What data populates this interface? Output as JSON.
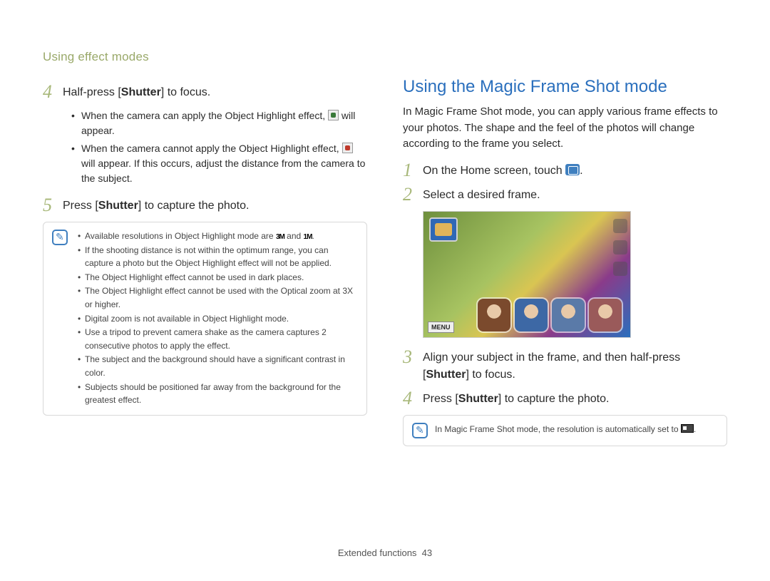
{
  "breadcrumb": "Using effect modes",
  "left": {
    "step4": {
      "num": "4",
      "pre": "Half-press [",
      "bold": "Shutter",
      "post": "] to focus."
    },
    "sub4": {
      "a_pre": "When the camera can apply the Object Highlight effect, ",
      "a_post": " will appear.",
      "b_pre": "When the camera cannot apply the Object Highlight effect, ",
      "b_post": " will appear. If this occurs, adjust the distance from the camera to the subject."
    },
    "step5": {
      "num": "5",
      "pre": "Press [",
      "bold": "Shutter",
      "post": "] to capture the photo."
    },
    "notes": {
      "n1a": "Available resolutions in Object Highlight mode are ",
      "n1b": " and ",
      "n1c": ".",
      "res1": "3M",
      "res2": "1M",
      "n2": "If the shooting distance is not within the optimum range, you can capture a photo but the Object Highlight effect will not be applied.",
      "n3": "The Object Highlight effect cannot be used in dark places.",
      "n4": "The Object Highlight effect cannot be used with the Optical zoom at 3X or higher.",
      "n5": "Digital zoom is not available in Object Highlight mode.",
      "n6": "Use a tripod to prevent camera shake as the camera captures 2 consecutive photos to apply the effect.",
      "n7": "The subject and the background should have a significant contrast in color.",
      "n8": "Subjects should be positioned far away from the background for the greatest effect."
    }
  },
  "right": {
    "title": "Using the Magic Frame Shot mode",
    "intro": "In Magic Frame Shot mode, you can apply various frame effects to your photos. The shape and the feel of the photos will change according to the frame you select.",
    "step1": {
      "num": "1",
      "pre": "On the Home screen, touch ",
      "post": "."
    },
    "step2": {
      "num": "2",
      "text": "Select a desired frame."
    },
    "menu_label": "MENU",
    "step3": {
      "num": "3",
      "pre": "Align your subject in the frame, and then half-press [",
      "bold": "Shutter",
      "post": "] to focus."
    },
    "step4": {
      "num": "4",
      "pre": "Press [",
      "bold": "Shutter",
      "post": "] to capture the photo."
    },
    "note": {
      "pre": "In Magic Frame Shot mode, the resolution is automatically set to ",
      "post": "."
    }
  },
  "footer": {
    "section": "Extended functions",
    "page": "43"
  }
}
